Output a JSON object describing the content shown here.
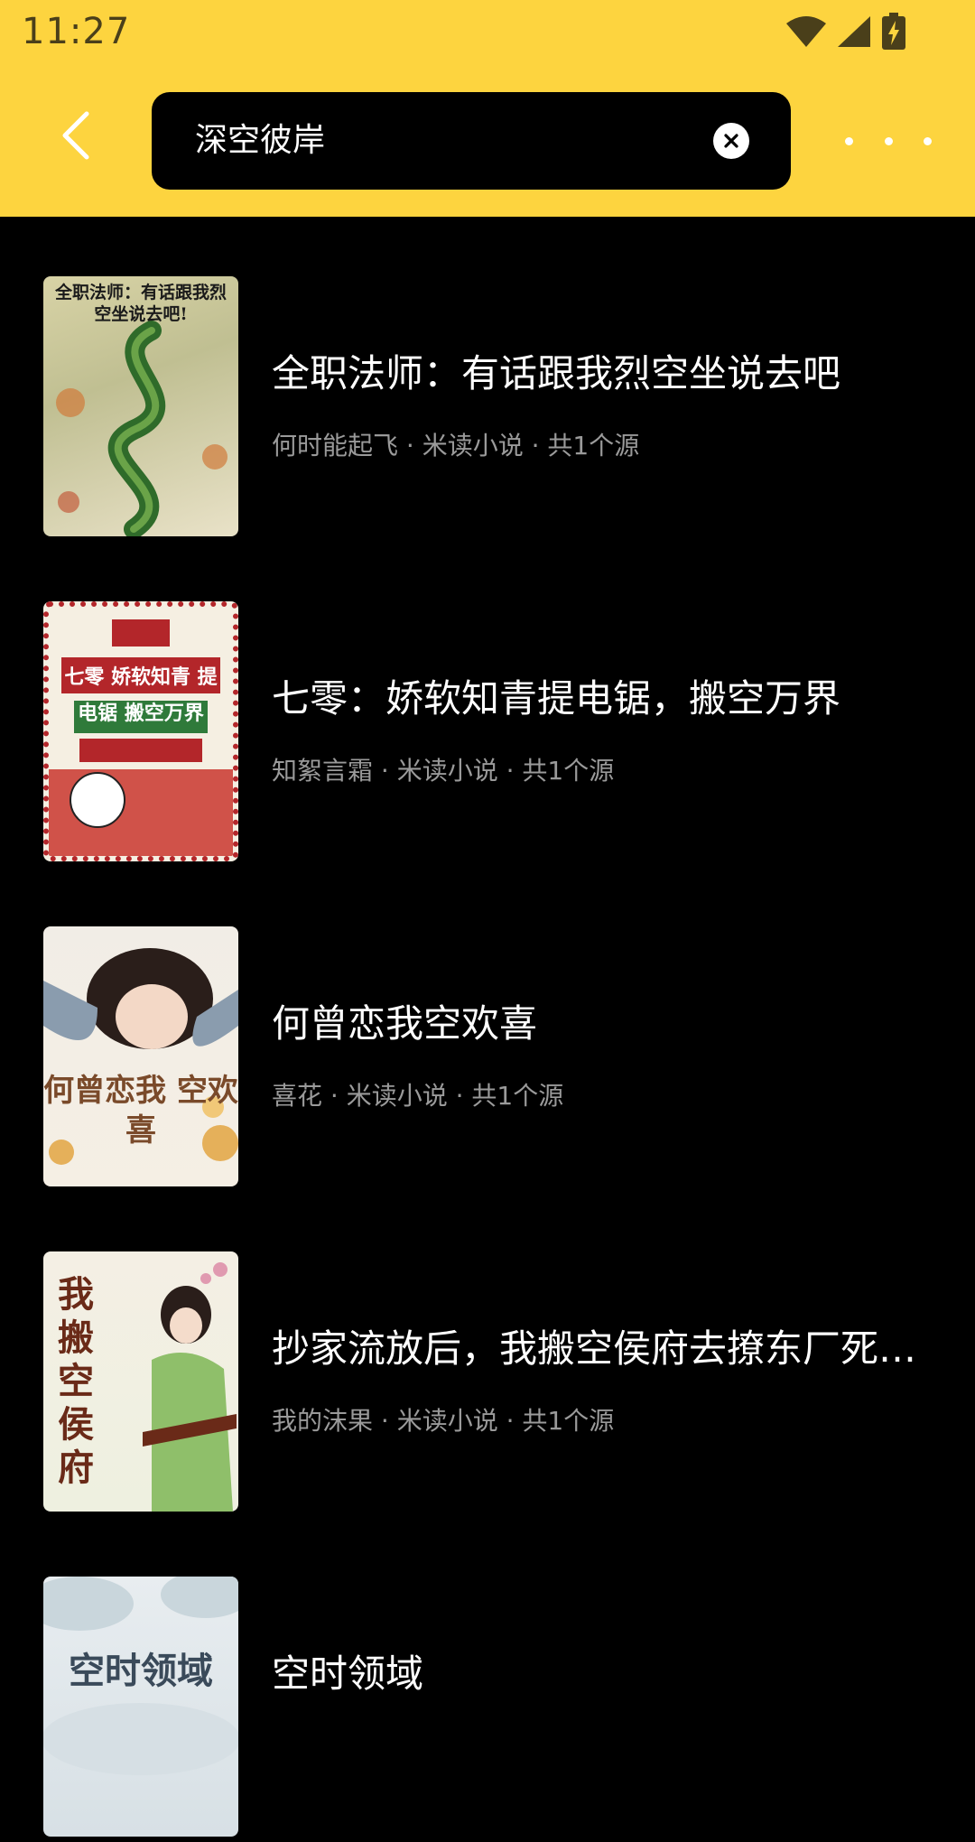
{
  "status_bar": {
    "time": "11:27"
  },
  "search": {
    "query": "深空彼岸"
  },
  "books": [
    {
      "title": "全职法师：有话跟我烈空坐说去吧",
      "meta": "何时能起飞 · 米读小说 · 共1个源",
      "cover_text": "全职法师：有话跟我烈空坐说去吧!",
      "cover_colors": [
        "#c8c79a",
        "#2f6b2a",
        "#f3efe0"
      ]
    },
    {
      "title": "七零：娇软知青提电锯，搬空万界",
      "meta": "知絮言霜 · 米读小说 · 共1个源",
      "cover_text": "七零 娇软知青 提电锯 搬空万界",
      "cover_colors": [
        "#b3262a",
        "#f5efe2",
        "#2f7a3a"
      ]
    },
    {
      "title": "何曾恋我空欢喜",
      "meta": "喜花 · 米读小说 · 共1个源",
      "cover_text": "何曾恋我 空欢喜",
      "cover_colors": [
        "#f3ebe0",
        "#e5b05a",
        "#7a4a2a"
      ]
    },
    {
      "title": "抄家流放后，我搬空侯府去撩东厂死对头",
      "meta": "我的沫果 · 米读小说 · 共1个源",
      "cover_text": "我搬空侯府",
      "cover_colors": [
        "#f2ece0",
        "#6a2a18",
        "#8fbf6a"
      ]
    },
    {
      "title": "空时领域",
      "meta": "",
      "cover_text": "空时领域",
      "cover_colors": [
        "#e8edf0",
        "#3a4a5a",
        "#c9d6dc"
      ]
    }
  ],
  "icons": {
    "back": "chevron-left-icon",
    "clear": "close-circle-icon",
    "more": "more-horizontal-icon",
    "wifi": "wifi-icon",
    "signal": "signal-icon",
    "battery": "battery-charging-icon"
  },
  "colors": {
    "header_bg": "#FDD43F",
    "page_bg": "#000000",
    "title_text": "#ffffff",
    "meta_text": "#9a9a9a"
  }
}
